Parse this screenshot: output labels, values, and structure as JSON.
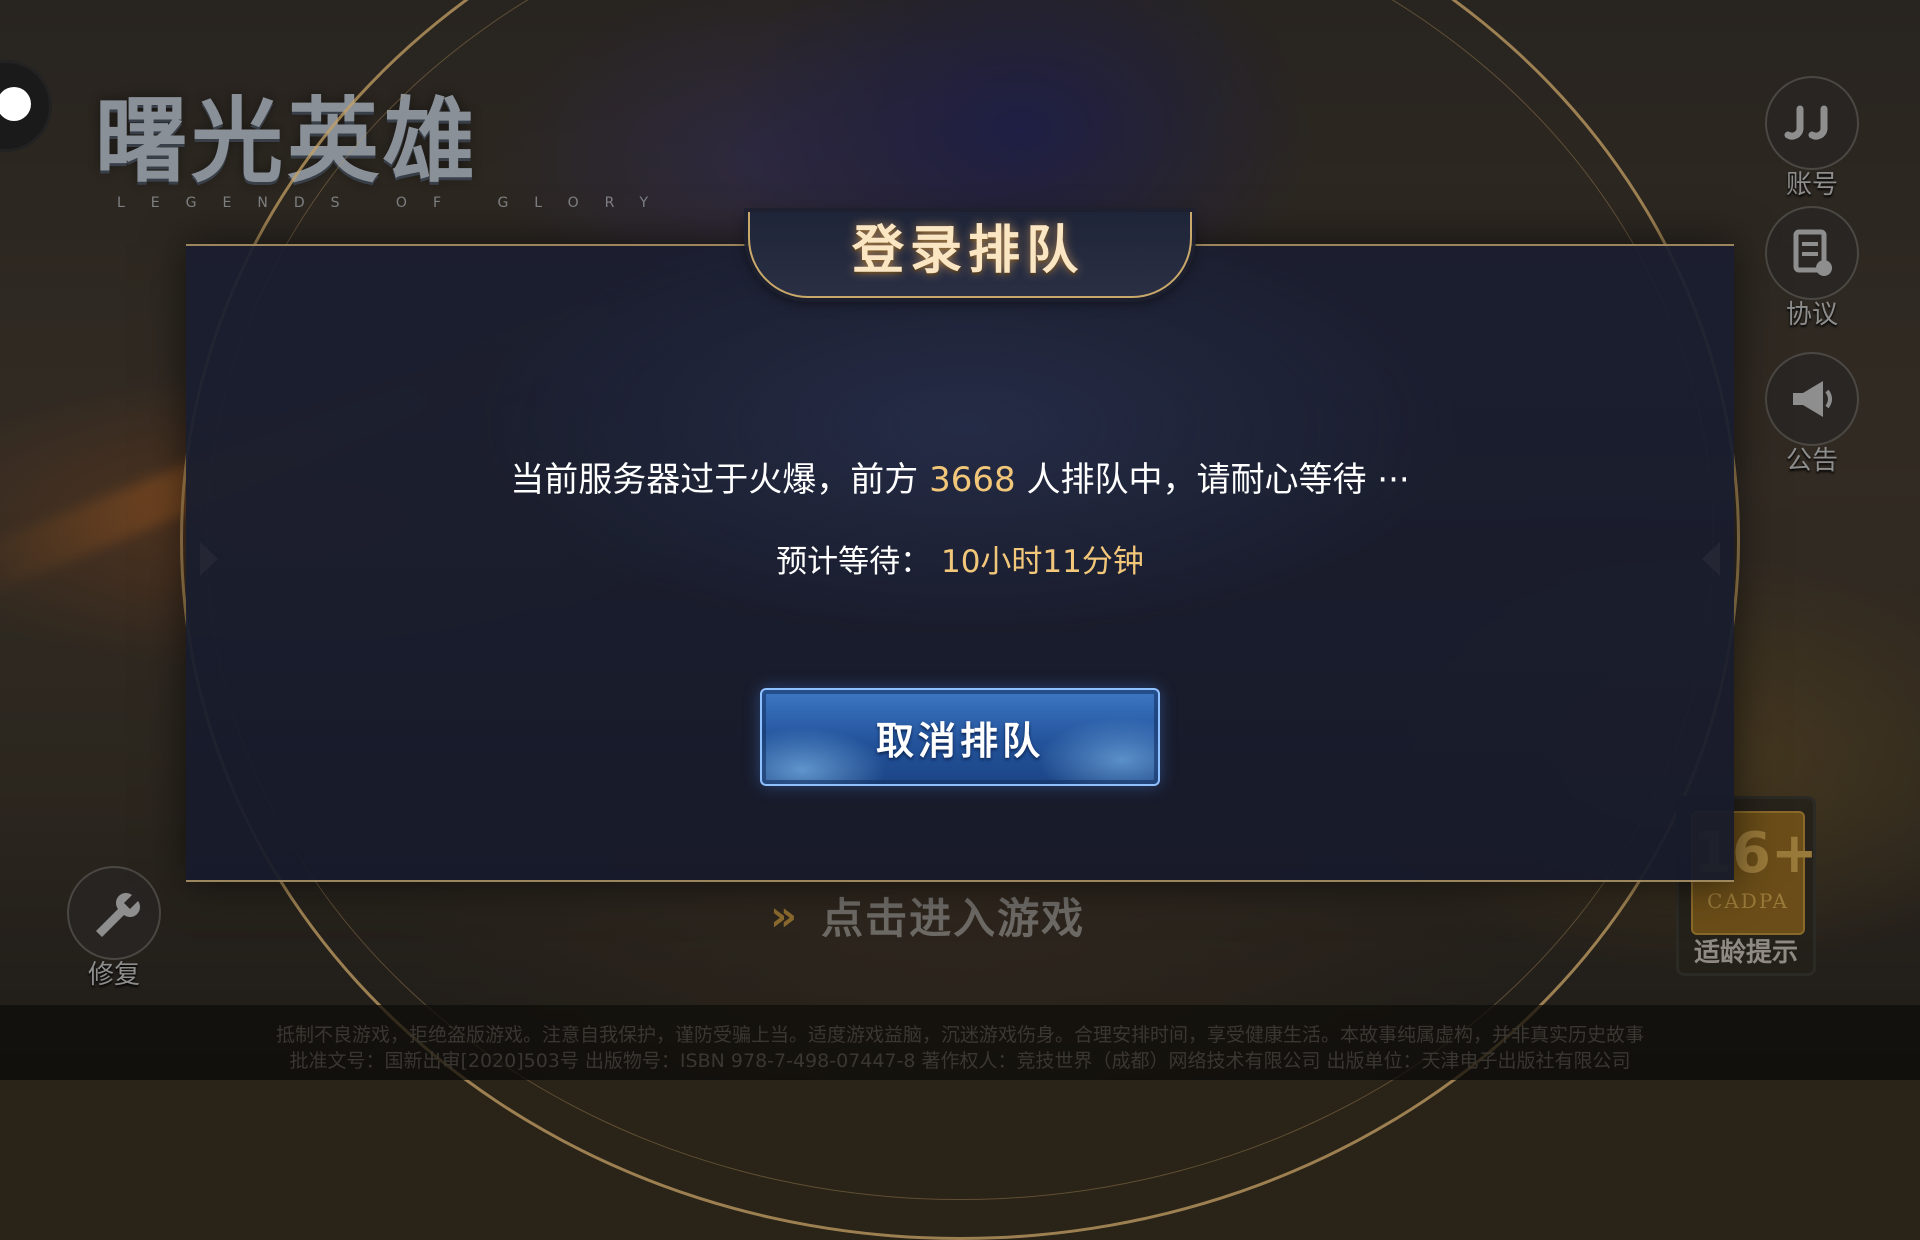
{
  "logo": {
    "title": "曙光英雄",
    "subtitle": "LEGENDS OF GLORY"
  },
  "side_menu": [
    {
      "icon": "jj-account-icon",
      "label": "账号"
    },
    {
      "icon": "agreement-icon",
      "label": "协议"
    },
    {
      "icon": "megaphone-icon",
      "label": "公告"
    }
  ],
  "repair": {
    "label": "修复"
  },
  "enter_game": {
    "label": "点击进入游戏"
  },
  "modal": {
    "title": "登录排队",
    "message_prefix": "当前服务器过于火爆，前方",
    "queue_count": "3668",
    "message_suffix": "人排队中，请耐心等待 ···",
    "wait_label": "预计等待：",
    "wait_time": "10小时11分钟",
    "cancel_label": "取消排队"
  },
  "age_rating": {
    "age": "16+",
    "org": "CADPA",
    "label": "适龄提示"
  },
  "legal": {
    "line1": "抵制不良游戏，拒绝盗版游戏。注意自我保护，谨防受骗上当。适度游戏益脑，沉迷游戏伤身。合理安排时间，享受健康生活。本故事纯属虚构，并非真实历史故事",
    "line2": "批准文号：国新出审[2020]503号 出版物号：ISBN 978-7-498-07447-8 著作权人：竞技世界（成都）网络技术有限公司 出版单位：天津电子出版社有限公司"
  },
  "colors": {
    "highlight": "#f2c77a",
    "gold_frame": "#c9a86a",
    "button_blue": "#2a5ea8"
  }
}
